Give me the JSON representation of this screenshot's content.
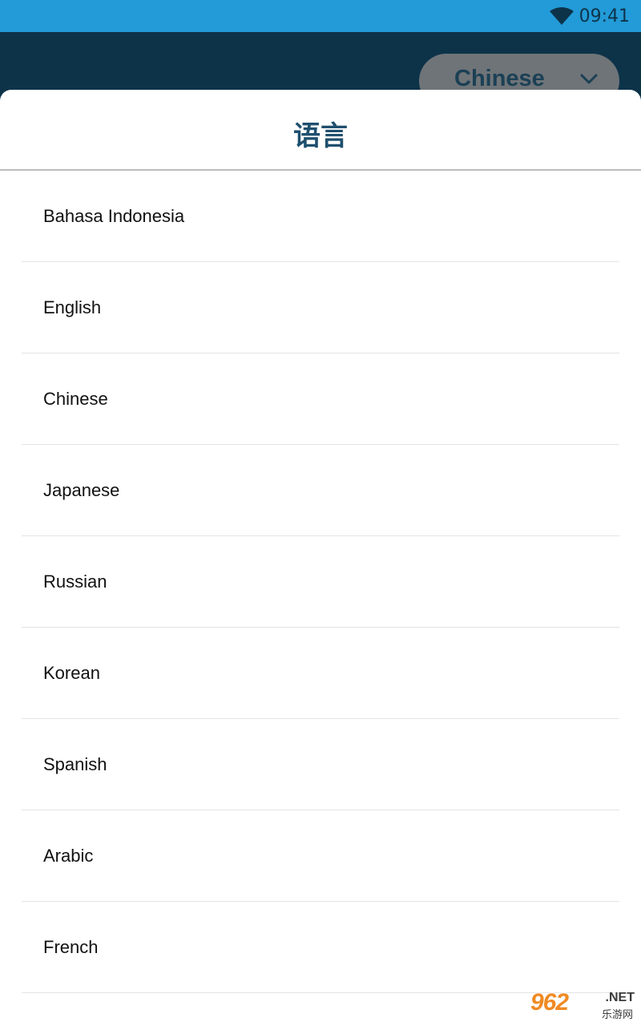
{
  "status_bar": {
    "time": "09:41",
    "wifi_icon": "wifi-icon",
    "color": "#229bd8"
  },
  "app_bar": {
    "language_button_label": "Chinese",
    "chevron_icon": "chevron-down-icon",
    "color": "#0d3349"
  },
  "sheet": {
    "title": "语言",
    "title_color": "#1f4f6e",
    "items": [
      {
        "label": "Bahasa Indonesia"
      },
      {
        "label": "English"
      },
      {
        "label": "Chinese"
      },
      {
        "label": "Japanese"
      },
      {
        "label": "Russian"
      },
      {
        "label": "Korean"
      },
      {
        "label": "Spanish"
      },
      {
        "label": "Arabic"
      },
      {
        "label": "French"
      }
    ]
  },
  "watermark": {
    "main": "962",
    "suffix": ".NET",
    "sub": "乐游网"
  }
}
